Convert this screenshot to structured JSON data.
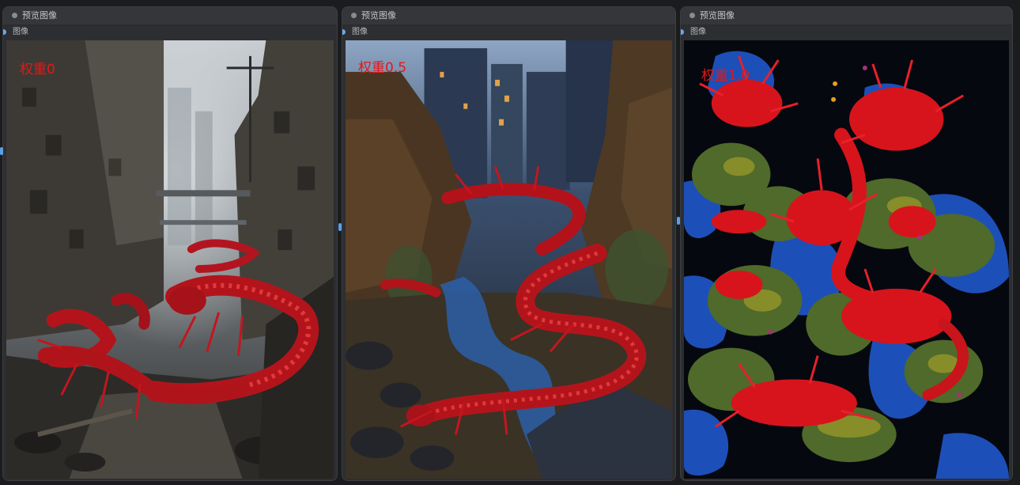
{
  "nodes": [
    {
      "title": "预览图像",
      "output_label": "图像",
      "weight_label": "权重0"
    },
    {
      "title": "预览图像",
      "output_label": "图像",
      "weight_label": "权重0.5"
    },
    {
      "title": "预览图像",
      "output_label": "图像",
      "weight_label": "权重1.0"
    }
  ],
  "colors": {
    "canvas_bg": "#1b1c1e",
    "node_bg": "#2d2e31",
    "header_bg": "#353639",
    "link_blue": "#6aa8e8",
    "weight_text": "#e11919"
  }
}
